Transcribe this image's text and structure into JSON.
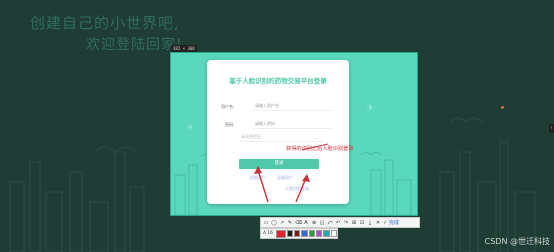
{
  "desktop": {
    "slogan_line1": "创建自己的小世界吧,",
    "slogan_line2": "欢迎登陆回家!",
    "watermark": "CSDN @世迁科技",
    "size_badge": "382 × 368"
  },
  "login": {
    "title": "基于人脸识别的药物交易平台登录",
    "username_label": "用户名:",
    "username_placeholder": "请输入用户名",
    "password_label": "密码:",
    "password_placeholder": "请输入密码",
    "captcha_placeholder": "请选择验证",
    "login_button": "登录",
    "register_link": "注册用户",
    "face_register_link": "注册用户",
    "forgot_link": "人脸识别登录"
  },
  "annotation": {
    "note": "获得的识别之后人脸识别登录"
  },
  "toolbar": {
    "tools": [
      "▭",
      "◯",
      "↗",
      "✎",
      "⌫",
      "A",
      "⊕",
      "◱",
      "⤺",
      "↶",
      "↷",
      "⊞",
      "⊡",
      "⤓",
      "✕",
      "✓"
    ],
    "done_label": "完成",
    "text_tool": "A",
    "font_size": "16",
    "colors": [
      "#e0242c",
      "#1d1d1d",
      "#7a1c1c",
      "#2b6adf",
      "#2d9b3a",
      "#b14ac8",
      "#26a7b8",
      "#ffffff"
    ]
  }
}
